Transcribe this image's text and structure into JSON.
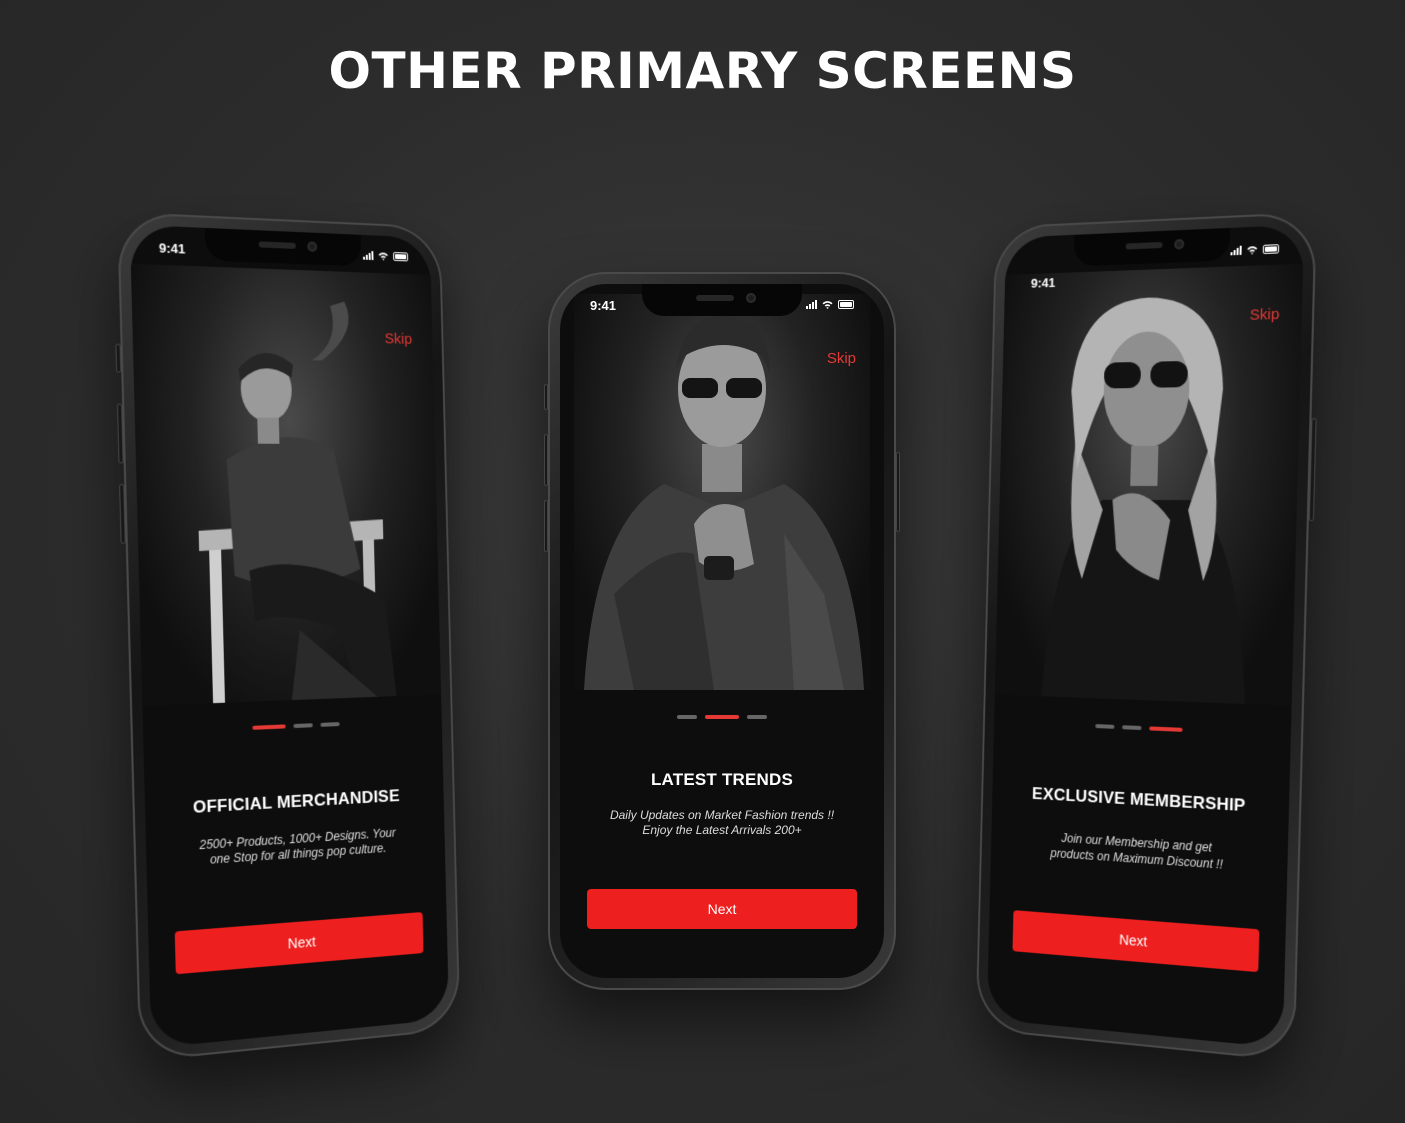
{
  "page": {
    "title": "OTHER PRIMARY SCREENS"
  },
  "accent_color": "#e53935",
  "screens": [
    {
      "time": "9:41",
      "skip": "Skip",
      "headline": "OFFICIAL MERCHANDISE",
      "body": "2500+ Products, 1000+ Designs. Your one Stop for all things pop culture.",
      "button": "Next",
      "active_dot": 0
    },
    {
      "time": "9:41",
      "skip": "Skip",
      "headline": "LATEST TRENDS",
      "body_line1": "Daily Updates on Market Fashion trends !!",
      "body_line2": "Enjoy the Latest Arrivals 200+",
      "button": "Next",
      "active_dot": 1
    },
    {
      "time": "9:41",
      "skip": "Skip",
      "headline": "EXCLUSIVE MEMBERSHIP",
      "body_line1": "Join our Membership and get",
      "body_line2": "products on Maximum Discount !!",
      "button": "Next",
      "active_dot": 2
    }
  ]
}
